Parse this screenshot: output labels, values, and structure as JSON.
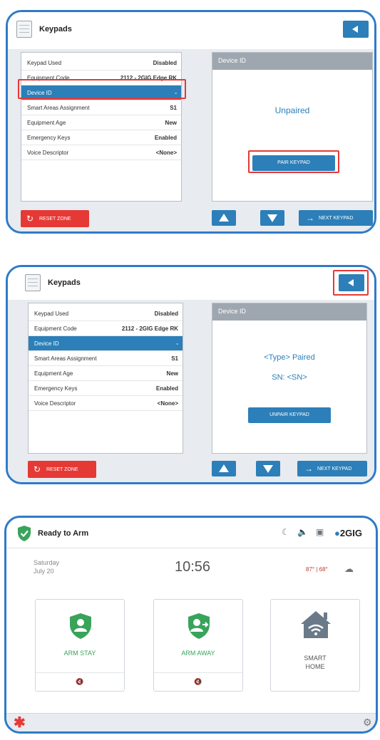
{
  "colors": {
    "accent": "#2c7fb8",
    "danger": "#e53935",
    "frame": "#2f7bc6",
    "success": "#3aa35b"
  },
  "screen1": {
    "title": "Keypads",
    "rows": [
      {
        "label": "Keypad Used",
        "value": "Disabled"
      },
      {
        "label": "Equipment Code",
        "value": "2112 - 2GIG Edge RK"
      },
      {
        "label": "Device ID",
        "value": "-"
      },
      {
        "label": "Smart Areas Assignment",
        "value": "S1"
      },
      {
        "label": "Equipment Age",
        "value": "New"
      },
      {
        "label": "Emergency Keys",
        "value": "Enabled"
      },
      {
        "label": "Voice Descriptor",
        "value": "<None>"
      }
    ],
    "device_panel_title": "Device ID",
    "status": "Unpaired",
    "pair_button": "PAIR KEYPAD",
    "reset_button": "RESET ZONE",
    "next_button": "NEXT KEYPAD"
  },
  "screen2": {
    "title": "Keypads",
    "rows": [
      {
        "label": "Keypad Used",
        "value": "Disabled"
      },
      {
        "label": "Equipment Code",
        "value": "2112 - 2GIG Edge RK"
      },
      {
        "label": "Device ID",
        "value": "-"
      },
      {
        "label": "Smart Areas Assignment",
        "value": "S1"
      },
      {
        "label": "Equipment Age",
        "value": "New"
      },
      {
        "label": "Emergency Keys",
        "value": "Enabled"
      },
      {
        "label": "Voice Descriptor",
        "value": "<None>"
      }
    ],
    "device_panel_title": "Device ID",
    "paired_text": "<Type> Paired",
    "sn_text": "SN: <SN>",
    "unpair_button": "UNPAIR KEYPAD",
    "reset_button": "RESET ZONE",
    "next_button": "NEXT KEYPAD"
  },
  "screen3": {
    "status": "Ready to Arm",
    "brand": "2GIG",
    "day": "Saturday",
    "date": "July 20",
    "time": "10:56",
    "weather": "87° | 68°",
    "tiles": [
      {
        "label": "ARM STAY",
        "foot": "🔇"
      },
      {
        "label": "ARM AWAY",
        "foot": "🔇"
      },
      {
        "label": "SMART\nHOME",
        "foot": ""
      }
    ],
    "icons": [
      "moon-icon",
      "volume-icon",
      "camera-icon",
      "brand-logo"
    ]
  }
}
